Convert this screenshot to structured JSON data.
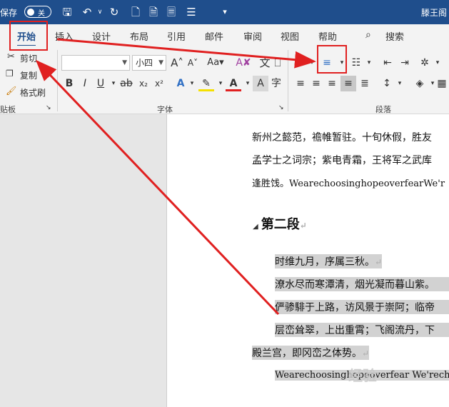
{
  "titlebar": {
    "autosave_label": "保存",
    "toggle_state": "关",
    "doc_title": "滕王阁"
  },
  "tabs": [
    "开始",
    "插入",
    "设计",
    "布局",
    "引用",
    "邮件",
    "审阅",
    "视图",
    "帮助",
    "搜索"
  ],
  "clipboard": {
    "cut": "剪切",
    "copy": "复制",
    "format_painter": "格式刷",
    "group_label": "贴板"
  },
  "font": {
    "font_name": "",
    "font_size": "小四",
    "group_label": "字体"
  },
  "paragraph": {
    "group_label": "段落"
  },
  "document": {
    "top_lines": [
      "新州之懿范，襜帷暂驻。十旬休假，胜友",
      "孟学士之词宗；紫电青霜，王将军之武库",
      "逢胜饯。WearechoosinghopeoverfearWe'r"
    ],
    "heading": "第二段",
    "section_lines": [
      "时维九月，序属三秋。",
      "潦水尽而寒潭清，烟光凝而暮山紫。",
      "俨骖騑于上路，访风景于崇阿；临帝",
      "层峦耸翠，上出重霄；飞阁流丹，下",
      "殿兰宫，即冈峦之体势。",
      "Wearechoosinghopeoverfear We'rechoo"
    ]
  },
  "colors": {
    "title_bar": "#1f4e8c",
    "ribbon_bg": "#f3f3f3",
    "annotation": "#e02020",
    "selection": "#d2d2d2"
  },
  "watermark": "经验"
}
